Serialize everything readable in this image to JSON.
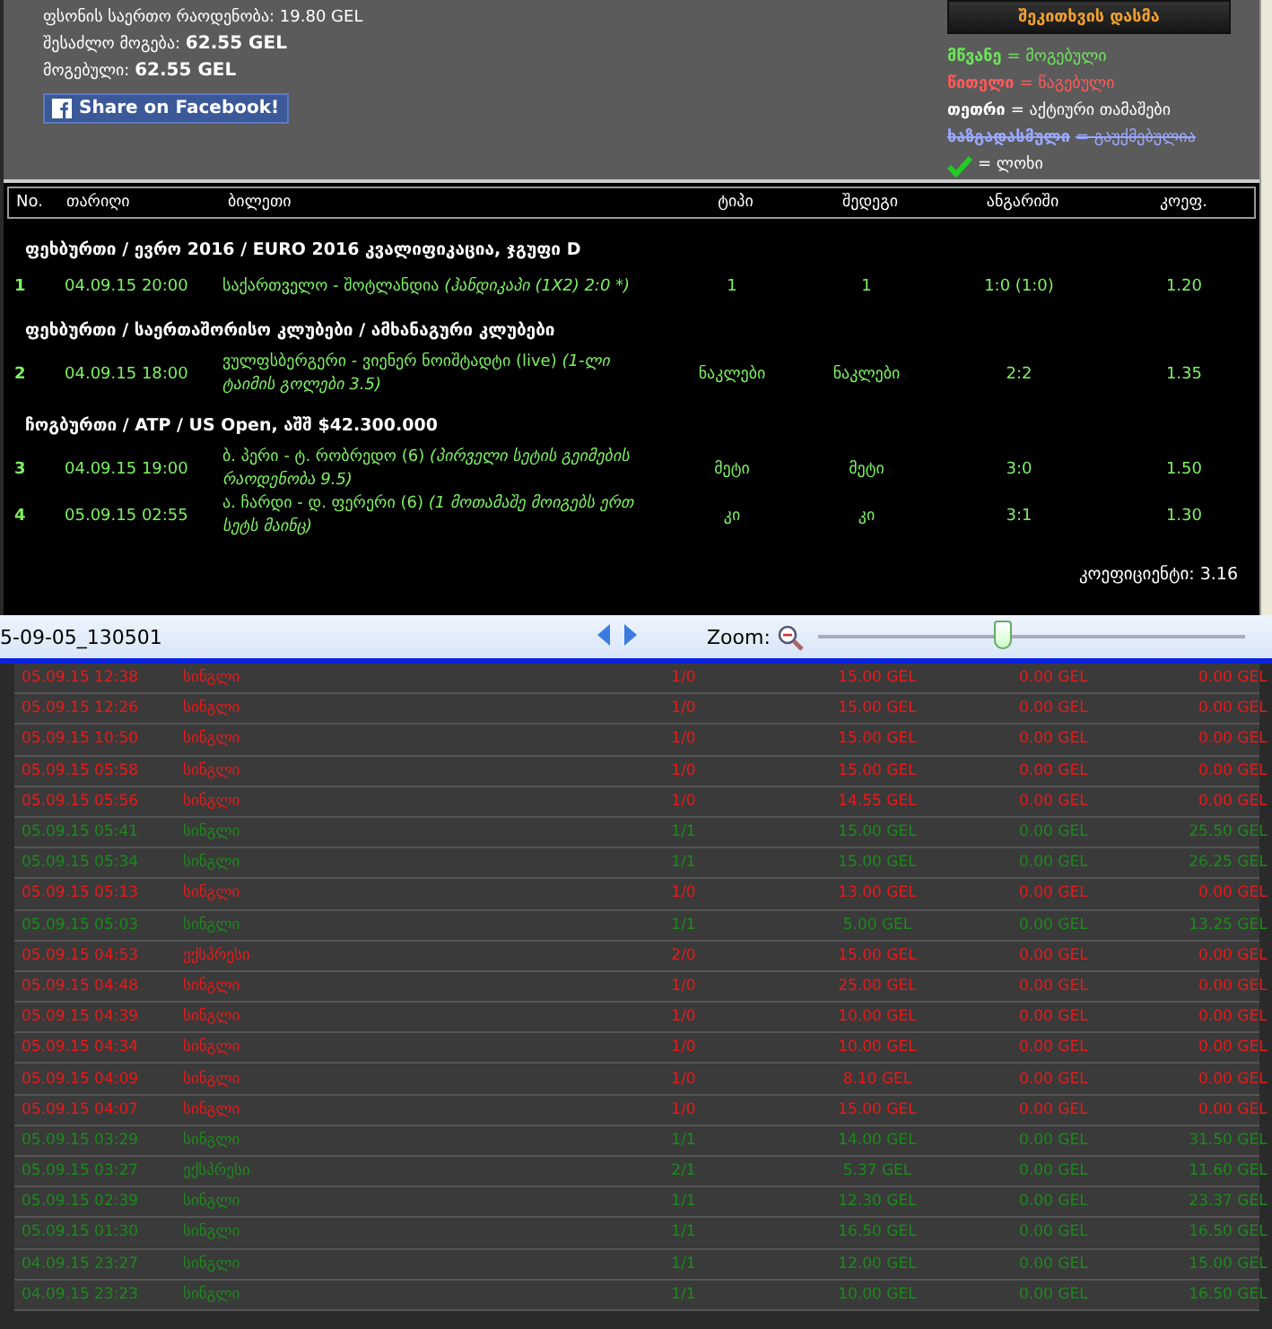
{
  "summary": [
    "ფსონის საერთო რაოდენობა: 19.80 GEL",
    "შესაძლო მოგება: **62.55 GEL**",
    "მოგებული: **62.55 GEL**"
  ],
  "share_button": "Share on Facebook!",
  "ask_button": "შეკითხვის დასმა",
  "legend": [
    {
      "kind": "won",
      "key": "მწვანე",
      "text": "= მოგებული"
    },
    {
      "kind": "lost",
      "key": "წითელი",
      "text": "= წაგებული"
    },
    {
      "kind": "active",
      "key": "თეთრი",
      "text": "= აქტიური თამაშები"
    },
    {
      "kind": "cancelled",
      "key": "ხაზგადასმული",
      "text": "= გაუქმებულია"
    },
    {
      "kind": "tick",
      "text": "= ლოხი"
    }
  ],
  "ticket": {
    "columns": [
      "No.",
      "თარიღი",
      "ბილეთი",
      "ტიპი",
      "შედეგი",
      "ანგარიში",
      "კოეფ."
    ],
    "groups": [
      {
        "title": "ფეხბურთი / ევრო 2016 / EURO 2016 კვალიფიკაცია, ჯგუფი D",
        "rows": [
          {
            "no": "1",
            "date": "04.09.15 20:00",
            "event": "საქართველო - შოტლანდია",
            "market": "(ჰანდიკაპი (1X2) 2:0 *)",
            "type": "1",
            "result": "1",
            "score": "1:0 (1:0)",
            "odds": "1.20"
          }
        ]
      },
      {
        "title": "ფეხბურთი / საერთაშორისო კლუბები / ამხანაგური კლუბები",
        "rows": [
          {
            "no": "2",
            "date": "04.09.15 18:00",
            "event": "ვულფსბერგერი - ვიენერ ნოიშტადტი (live)",
            "market": "(1-ლი ტაიმის გოლები 3.5)",
            "type": "ნაკლები",
            "result": "ნაკლები",
            "score": "2:2",
            "odds": "1.35"
          }
        ]
      },
      {
        "title": "ჩოგბურთი / ATP / US Open, აშშ $42.300.000",
        "rows": [
          {
            "no": "3",
            "date": "04.09.15 19:00",
            "event": "ბ. პერი - ტ. რობრედო (6)",
            "market": "(პირველი სეტის გეიმების რაოდენობა 9.5)",
            "type": "მეტი",
            "result": "მეტი",
            "score": "3:0",
            "odds": "1.50"
          },
          {
            "no": "4",
            "date": "05.09.15 02:55",
            "event": "ა. ჩარდი - დ. ფერერი (6)",
            "market": "(1 მოთამაშე მოიგებს ერთ სეტს მაინც)",
            "type": "კი",
            "result": "კი",
            "score": "3:1",
            "odds": "1.30"
          }
        ]
      }
    ],
    "total": "კოეფიციენტი: 3.16"
  },
  "viewer": {
    "filename": "5-09-05_130501",
    "zoom_label": "Zoom:",
    "zoom": {
      "level": 0.43
    }
  },
  "history": [
    {
      "won": false,
      "date": "05.09.15 12:38",
      "type": "სინგლი",
      "count": "1/0",
      "stake": "15.00 GEL",
      "bonus": "0.00 GEL",
      "win": "0.00 GEL"
    },
    {
      "won": false,
      "date": "05.09.15 12:26",
      "type": "სინგლი",
      "count": "1/0",
      "stake": "15.00 GEL",
      "bonus": "0.00 GEL",
      "win": "0.00 GEL"
    },
    {
      "won": false,
      "date": "05.09.15 10:50",
      "type": "სინგლი",
      "count": "1/0",
      "stake": "15.00 GEL",
      "bonus": "0.00 GEL",
      "win": "0.00 GEL"
    },
    {
      "won": false,
      "date": "05.09.15 05:58",
      "type": "სინგლი",
      "count": "1/0",
      "stake": "15.00 GEL",
      "bonus": "0.00 GEL",
      "win": "0.00 GEL"
    },
    {
      "won": false,
      "date": "05.09.15 05:56",
      "type": "სინგლი",
      "count": "1/0",
      "stake": "14.55 GEL",
      "bonus": "0.00 GEL",
      "win": "0.00 GEL"
    },
    {
      "won": true,
      "date": "05.09.15 05:41",
      "type": "სინგლი",
      "count": "1/1",
      "stake": "15.00 GEL",
      "bonus": "0.00 GEL",
      "win": "25.50 GEL"
    },
    {
      "won": true,
      "date": "05.09.15 05:34",
      "type": "სინგლი",
      "count": "1/1",
      "stake": "15.00 GEL",
      "bonus": "0.00 GEL",
      "win": "26.25 GEL"
    },
    {
      "won": false,
      "date": "05.09.15 05:13",
      "type": "სინგლი",
      "count": "1/0",
      "stake": "13.00 GEL",
      "bonus": "0.00 GEL",
      "win": "0.00 GEL"
    },
    {
      "won": true,
      "date": "05.09.15 05:03",
      "type": "სინგლი",
      "count": "1/1",
      "stake": "5.00 GEL",
      "bonus": "0.00 GEL",
      "win": "13.25 GEL"
    },
    {
      "won": false,
      "date": "05.09.15 04:53",
      "type": "ექსპრესი",
      "count": "2/0",
      "stake": "15.00 GEL",
      "bonus": "0.00 GEL",
      "win": "0.00 GEL"
    },
    {
      "won": false,
      "date": "05.09.15 04:48",
      "type": "სინგლი",
      "count": "1/0",
      "stake": "25.00 GEL",
      "bonus": "0.00 GEL",
      "win": "0.00 GEL"
    },
    {
      "won": false,
      "date": "05.09.15 04:39",
      "type": "სინგლი",
      "count": "1/0",
      "stake": "10.00 GEL",
      "bonus": "0.00 GEL",
      "win": "0.00 GEL"
    },
    {
      "won": false,
      "date": "05.09.15 04:34",
      "type": "სინგლი",
      "count": "1/0",
      "stake": "10.00 GEL",
      "bonus": "0.00 GEL",
      "win": "0.00 GEL"
    },
    {
      "won": false,
      "date": "05.09.15 04:09",
      "type": "სინგლი",
      "count": "1/0",
      "stake": "8.10 GEL",
      "bonus": "0.00 GEL",
      "win": "0.00 GEL"
    },
    {
      "won": false,
      "date": "05.09.15 04:07",
      "type": "სინგლი",
      "count": "1/0",
      "stake": "15.00 GEL",
      "bonus": "0.00 GEL",
      "win": "0.00 GEL"
    },
    {
      "won": true,
      "date": "05.09.15 03:29",
      "type": "სინგლი",
      "count": "1/1",
      "stake": "14.00 GEL",
      "bonus": "0.00 GEL",
      "win": "31.50 GEL"
    },
    {
      "won": true,
      "date": "05.09.15 03:27",
      "type": "ექსპრესი",
      "count": "2/1",
      "stake": "5.37 GEL",
      "bonus": "0.00 GEL",
      "win": "11.60 GEL"
    },
    {
      "won": true,
      "date": "05.09.15 02:39",
      "type": "სინგლი",
      "count": "1/1",
      "stake": "12.30 GEL",
      "bonus": "0.00 GEL",
      "win": "23.37 GEL"
    },
    {
      "won": true,
      "date": "05.09.15 01:30",
      "type": "სინგლი",
      "count": "1/1",
      "stake": "16.50 GEL",
      "bonus": "0.00 GEL",
      "win": "16.50 GEL"
    },
    {
      "won": true,
      "date": "04.09.15 23:27",
      "type": "სინგლი",
      "count": "1/1",
      "stake": "12.00 GEL",
      "bonus": "0.00 GEL",
      "win": "15.00 GEL"
    },
    {
      "won": true,
      "date": "04.09.15 23:23",
      "type": "სინგლი",
      "count": "1/1",
      "stake": "10.00 GEL",
      "bonus": "0.00 GEL",
      "win": "16.50 GEL"
    }
  ]
}
